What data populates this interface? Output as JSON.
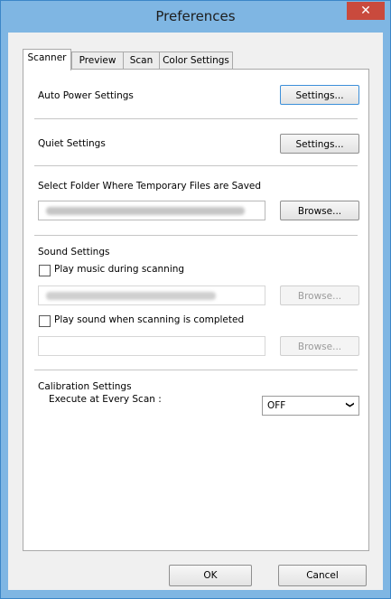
{
  "window": {
    "title": "Preferences",
    "close_glyph": "✕"
  },
  "tabs": [
    {
      "label": "Scanner",
      "active": true
    },
    {
      "label": "Preview",
      "active": false
    },
    {
      "label": "Scan",
      "active": false
    },
    {
      "label": "Color Settings",
      "active": false
    }
  ],
  "auto_power": {
    "label": "Auto Power Settings",
    "button": "Settings..."
  },
  "quiet": {
    "label": "Quiet Settings",
    "button": "Settings..."
  },
  "temp_folder": {
    "label": "Select Folder Where Temporary Files are Saved",
    "button": "Browse..."
  },
  "sound": {
    "label": "Sound Settings",
    "play_music_label": "Play music during scanning",
    "play_music_checked": false,
    "music_browse": "Browse...",
    "play_sound_label": "Play sound when scanning is completed",
    "play_sound_checked": false,
    "sound_browse": "Browse..."
  },
  "calibration": {
    "label": "Calibration Settings",
    "execute_label": "Execute at Every Scan :",
    "execute_value": "OFF",
    "dropdown_glyph": "❯"
  },
  "footer": {
    "ok": "OK",
    "cancel": "Cancel"
  },
  "colors": {
    "titlebar": "#7fb6e3",
    "close_button": "#c94a3d",
    "focus_border": "#3c8fd9"
  }
}
